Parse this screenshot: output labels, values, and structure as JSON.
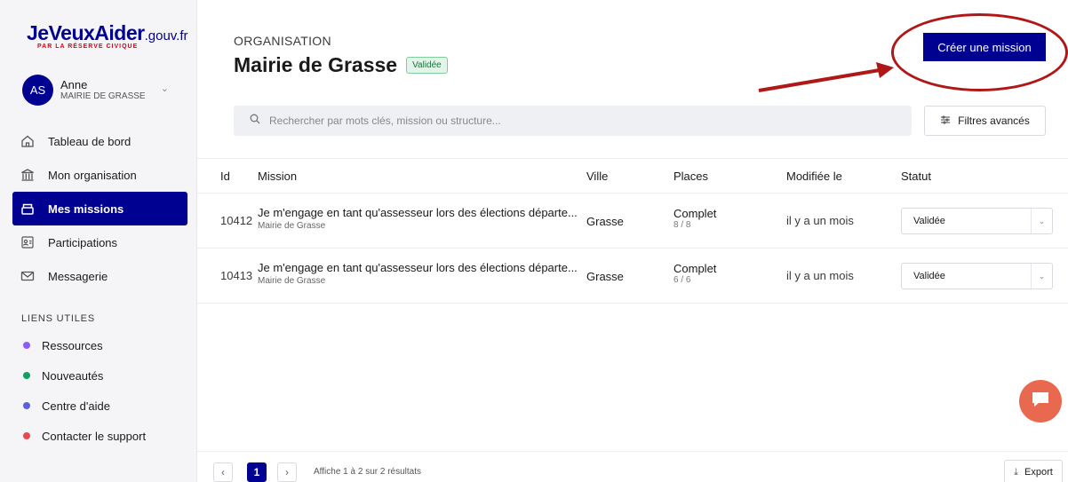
{
  "brand": {
    "name": "JeVeuxAider",
    "suffix": ".gouv.fr",
    "tagline": "PAR LA RÉSERVE CIVIQUE",
    "color": "#000091"
  },
  "user": {
    "initials": "AS",
    "name": "Anne",
    "organization": "MAIRIE DE GRASSE"
  },
  "nav": {
    "items": [
      {
        "label": "Tableau de bord",
        "icon": "home-icon"
      },
      {
        "label": "Mon organisation",
        "icon": "building-icon"
      },
      {
        "label": "Mes missions",
        "icon": "missions-icon",
        "active": true
      },
      {
        "label": "Participations",
        "icon": "participations-icon"
      },
      {
        "label": "Messagerie",
        "icon": "mail-icon"
      }
    ]
  },
  "links": {
    "title": "LIENS UTILES",
    "items": [
      {
        "label": "Ressources",
        "color": "#8b5cf6"
      },
      {
        "label": "Nouveautés",
        "color": "#10a060"
      },
      {
        "label": "Centre d'aide",
        "color": "#5b5fe0"
      },
      {
        "label": "Contacter le support",
        "color": "#e5484d"
      }
    ]
  },
  "header": {
    "section_label": "ORGANISATION",
    "title": "Mairie de Grasse",
    "status_badge": "Validée",
    "create_button": "Créer une mission"
  },
  "search": {
    "placeholder": "Rechercher par mots clés, mission ou structure..."
  },
  "filters_button": "Filtres avancés",
  "table": {
    "columns": [
      "Id",
      "Mission",
      "Ville",
      "Places",
      "Modifiée le",
      "Statut"
    ],
    "rows": [
      {
        "id": "10412",
        "mission": "Je m'engage en tant qu'assesseur lors des élections départe...",
        "structure": "Mairie de Grasse",
        "ville": "Grasse",
        "places_status": "Complet",
        "places_count": "8 / 8",
        "modified": "il y a un mois",
        "statut": "Validée"
      },
      {
        "id": "10413",
        "mission": "Je m'engage en tant qu'assesseur lors des élections départe...",
        "structure": "Mairie de Grasse",
        "ville": "Grasse",
        "places_status": "Complet",
        "places_count": "6 / 6",
        "modified": "il y a un mois",
        "statut": "Validée"
      }
    ]
  },
  "pagination": {
    "prev": "‹",
    "current": "1",
    "next": "›",
    "info": "Affiche 1 à 2 sur 2 résultats"
  },
  "export_button": "Export",
  "annotation_color": "#b01818"
}
